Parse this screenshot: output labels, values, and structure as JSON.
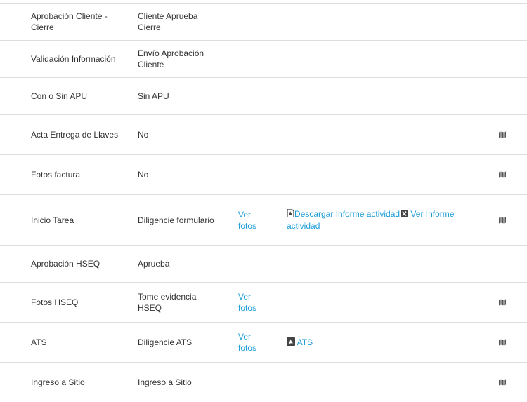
{
  "rows": [
    {
      "label": "Aprobación Cliente -\nCierre",
      "value": "Cliente Aprueba\nCierre"
    },
    {
      "label": "Validación Información",
      "value": "Envío Aprobación\nCliente"
    },
    {
      "label": "Con o Sin APU",
      "value": "Sin APU"
    },
    {
      "label": "Acta Entrega de Llaves",
      "value": "No",
      "icon": "map-icon"
    },
    {
      "label": "Fotos factura",
      "value": "No",
      "icon": "map-icon"
    },
    {
      "label": "Inicio Tarea",
      "value": "Diligencie formulario",
      "photos_link": "Ver\nfotos",
      "download_link": "Descargar Informe actividad",
      "download_icon": "pdf-file-icon",
      "view_link": "Ver Informe\nactividad",
      "view_icon": "excel-icon",
      "icon": "map-icon"
    },
    {
      "label": "Aprobación HSEQ",
      "value": "Aprueba"
    },
    {
      "label": "Fotos HSEQ",
      "value": "Tome evidencia\nHSEQ",
      "photos_link": "Ver\nfotos",
      "icon": "map-icon"
    },
    {
      "label": "ATS",
      "value": "Diligencie ATS",
      "photos_link": "Ver\nfotos",
      "ats_link": "ATS",
      "ats_icon": "pdf-icon",
      "icon": "map-icon"
    },
    {
      "label": "Ingreso a Sitio",
      "value": "Ingreso a Sitio",
      "icon": "map-icon"
    }
  ],
  "colors": {
    "link": "#1a9bd7",
    "text": "#333333",
    "border": "#dddddd",
    "icon": "#555555"
  }
}
